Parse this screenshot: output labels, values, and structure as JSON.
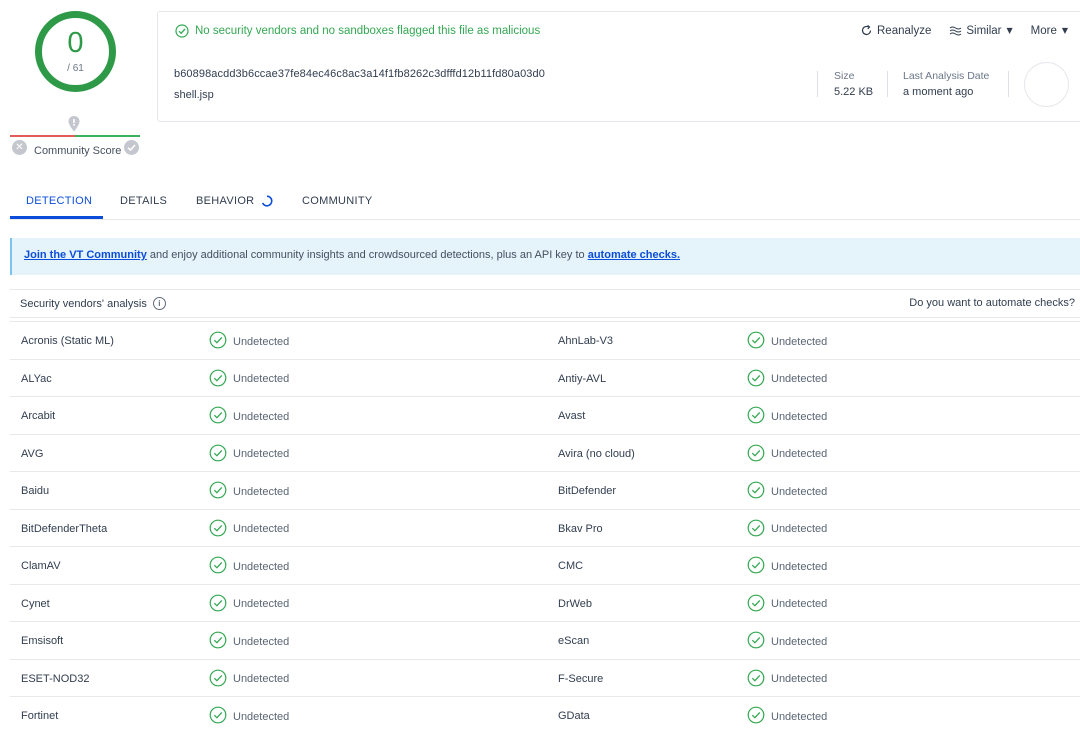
{
  "score": {
    "detections": "0",
    "total": "/ 61",
    "color": "#2e9a48"
  },
  "community": {
    "label": "Community Score"
  },
  "header": {
    "status": "No security vendors and no sandboxes flagged this file as malicious",
    "actions": {
      "reanalyze": "Reanalyze",
      "similar": "Similar",
      "more": "More"
    },
    "hash": "b60898acdd3b6ccae37fe84ec46c8ac3a14f1fb8262c3dfffd12b11fd80a03d0",
    "filename": "shell.jsp",
    "size_label": "Size",
    "size_value": "5.22 KB",
    "last_analysis_label": "Last Analysis Date",
    "last_analysis_value": "a moment ago"
  },
  "tabs": [
    {
      "label": "DETECTION"
    },
    {
      "label": "DETAILS"
    },
    {
      "label": "BEHAVIOR"
    },
    {
      "label": "COMMUNITY"
    }
  ],
  "banner": {
    "link1": "Join the VT Community",
    "text": " and enjoy additional community insights and crowdsourced detections, plus an API key to ",
    "link2": "automate checks."
  },
  "vendors": {
    "title": "Security vendors' analysis",
    "right": "Do you want to automate checks?",
    "rows": [
      {
        "left": "Acronis (Static ML)",
        "left_result": "Undetected",
        "right": "AhnLab-V3",
        "right_result": "Undetected"
      },
      {
        "left": "ALYac",
        "left_result": "Undetected",
        "right": "Antiy-AVL",
        "right_result": "Undetected"
      },
      {
        "left": "Arcabit",
        "left_result": "Undetected",
        "right": "Avast",
        "right_result": "Undetected"
      },
      {
        "left": "AVG",
        "left_result": "Undetected",
        "right": "Avira (no cloud)",
        "right_result": "Undetected"
      },
      {
        "left": "Baidu",
        "left_result": "Undetected",
        "right": "BitDefender",
        "right_result": "Undetected"
      },
      {
        "left": "BitDefenderTheta",
        "left_result": "Undetected",
        "right": "Bkav Pro",
        "right_result": "Undetected"
      },
      {
        "left": "ClamAV",
        "left_result": "Undetected",
        "right": "CMC",
        "right_result": "Undetected"
      },
      {
        "left": "Cynet",
        "left_result": "Undetected",
        "right": "DrWeb",
        "right_result": "Undetected"
      },
      {
        "left": "Emsisoft",
        "left_result": "Undetected",
        "right": "eScan",
        "right_result": "Undetected"
      },
      {
        "left": "ESET-NOD32",
        "left_result": "Undetected",
        "right": "F-Secure",
        "right_result": "Undetected"
      },
      {
        "left": "Fortinet",
        "left_result": "Undetected",
        "right": "GData",
        "right_result": "Undetected"
      }
    ]
  },
  "colors": {
    "accent": "#0b4dda",
    "clean": "#34a853",
    "banner_bg": "#e5f3fb"
  }
}
